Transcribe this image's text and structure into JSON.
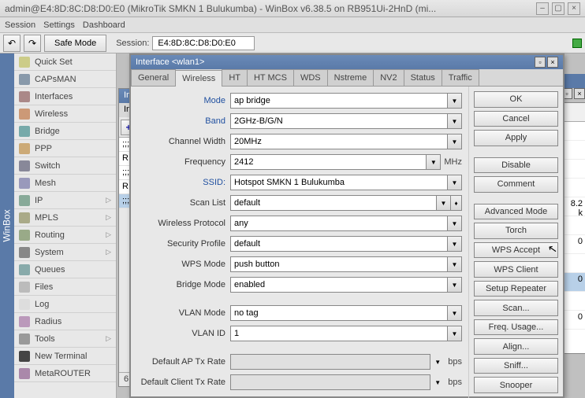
{
  "window": {
    "title": "admin@E4:8D:8C:D8:D0:E0 (MikroTik SMKN 1 Bulukumba) - WinBox v6.38.5 on RB951Ui-2HnD (mi..."
  },
  "menubar": {
    "items": [
      "Session",
      "Settings",
      "Dashboard"
    ]
  },
  "toolbar": {
    "safe_mode": "Safe Mode",
    "session_label": "Session:",
    "session_value": "E4:8D:8C:D8:D0:E0"
  },
  "nav": {
    "items": [
      {
        "label": "Quick Set",
        "icon": "qs"
      },
      {
        "label": "CAPsMAN",
        "icon": "cap"
      },
      {
        "label": "Interfaces",
        "icon": "if"
      },
      {
        "label": "Wireless",
        "icon": "wl"
      },
      {
        "label": "Bridge",
        "icon": "br"
      },
      {
        "label": "PPP",
        "icon": "ppp"
      },
      {
        "label": "Switch",
        "icon": "sw"
      },
      {
        "label": "Mesh",
        "icon": "mesh"
      },
      {
        "label": "IP",
        "icon": "ip",
        "sub": true
      },
      {
        "label": "MPLS",
        "icon": "mpls",
        "sub": true
      },
      {
        "label": "Routing",
        "icon": "rt",
        "sub": true
      },
      {
        "label": "System",
        "icon": "sys",
        "sub": true
      },
      {
        "label": "Queues",
        "icon": "qu"
      },
      {
        "label": "Files",
        "icon": "fi"
      },
      {
        "label": "Log",
        "icon": "log"
      },
      {
        "label": "Radius",
        "icon": "rad"
      },
      {
        "label": "Tools",
        "icon": "tool",
        "sub": true
      },
      {
        "label": "New Terminal",
        "icon": "term"
      },
      {
        "label": "MetaROUTER",
        "icon": "meta"
      }
    ]
  },
  "sidebar_vert": "WinBox",
  "bgwin": {
    "title": "Interface List",
    "subtitle": "Interface",
    "rows": [
      {
        "flag": ";;;"
      },
      {
        "flag": "R"
      },
      {
        "flag": ";;;"
      },
      {
        "flag": "R"
      },
      {
        "flag": ";;;"
      }
    ],
    "footer": "6 items"
  },
  "bgwin2": {
    "cells": [
      "",
      "",
      "",
      "",
      "",
      "8.2 k",
      "",
      "0",
      "",
      "0",
      "",
      "0"
    ]
  },
  "dialog": {
    "title": "Interface <wlan1>",
    "tabs": [
      "General",
      "Wireless",
      "HT",
      "HT MCS",
      "WDS",
      "Nstreme",
      "NV2",
      "Status",
      "Traffic"
    ],
    "active_tab": 1,
    "fields": {
      "mode": {
        "label": "Mode",
        "value": "ap bridge",
        "blue": true
      },
      "band": {
        "label": "Band",
        "value": "2GHz-B/G/N",
        "blue": true
      },
      "cwidth": {
        "label": "Channel Width",
        "value": "20MHz"
      },
      "freq": {
        "label": "Frequency",
        "value": "2412",
        "unit": "MHz"
      },
      "ssid": {
        "label": "SSID:",
        "value": "Hotspot SMKN 1 Bulukumba",
        "blue": true
      },
      "scan": {
        "label": "Scan List",
        "value": "default"
      },
      "proto": {
        "label": "Wireless Protocol",
        "value": "any"
      },
      "sec": {
        "label": "Security Profile",
        "value": "default"
      },
      "wps": {
        "label": "WPS Mode",
        "value": "push button"
      },
      "bridge": {
        "label": "Bridge Mode",
        "value": "enabled"
      },
      "vlanmode": {
        "label": "VLAN Mode",
        "value": "no tag"
      },
      "vlanid": {
        "label": "VLAN ID",
        "value": "1"
      },
      "aptx": {
        "label": "Default AP Tx Rate",
        "value": "",
        "unit": "bps"
      },
      "cltx": {
        "label": "Default Client Tx Rate",
        "value": "",
        "unit": "bps"
      }
    },
    "buttons": {
      "ok": "OK",
      "cancel": "Cancel",
      "apply": "Apply",
      "disable": "Disable",
      "comment": "Comment",
      "adv": "Advanced Mode",
      "torch": "Torch",
      "wpsa": "WPS Accept",
      "wpsc": "WPS Client",
      "setup": "Setup Repeater",
      "scan": "Scan...",
      "freq": "Freq. Usage...",
      "align": "Align...",
      "sniff": "Sniff...",
      "snoop": "Snooper"
    }
  }
}
